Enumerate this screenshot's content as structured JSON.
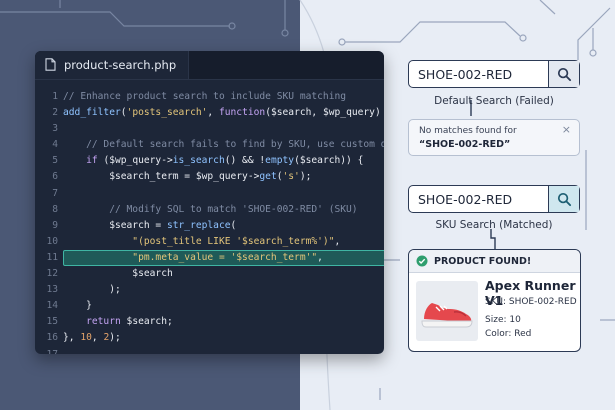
{
  "editor": {
    "tab_label": "product-search.php",
    "lines": [
      {
        "n": "1",
        "segs": [
          [
            "c-com",
            "// Enhance product search to include SKU matching"
          ]
        ]
      },
      {
        "n": "2",
        "segs": [
          [
            "c-fn",
            "add_filter"
          ],
          [
            "c-var",
            "("
          ],
          [
            "c-str",
            "'posts_search'"
          ],
          [
            "c-var",
            ", "
          ],
          [
            "c-kw",
            "function"
          ],
          [
            "c-var",
            "($search, $wp_query) {"
          ]
        ]
      },
      {
        "n": "3",
        "segs": []
      },
      {
        "n": "4",
        "segs": [
          [
            "c-com",
            "    // Default search fails to find by SKU, use custom query"
          ]
        ]
      },
      {
        "n": "5",
        "segs": [
          [
            "c-kw",
            "    if "
          ],
          [
            "c-var",
            "($wp_query->"
          ],
          [
            "c-fn",
            "is_search"
          ],
          [
            "c-var",
            "() && !"
          ],
          [
            "c-fn",
            "empty"
          ],
          [
            "c-var",
            "($search)) {"
          ]
        ]
      },
      {
        "n": "6",
        "segs": [
          [
            "c-var",
            "        $search_term = $wp_query->"
          ],
          [
            "c-fn",
            "get"
          ],
          [
            "c-var",
            "("
          ],
          [
            "c-str",
            "'s'"
          ],
          [
            "c-var",
            ");"
          ]
        ]
      },
      {
        "n": "7",
        "segs": []
      },
      {
        "n": "8",
        "segs": [
          [
            "c-com",
            "        // Modify SQL to match 'SHOE-002-RED' (SKU)"
          ]
        ]
      },
      {
        "n": "9",
        "segs": [
          [
            "c-var",
            "        $search = "
          ],
          [
            "c-fn",
            "str_replace"
          ],
          [
            "c-var",
            "("
          ]
        ]
      },
      {
        "n": "10",
        "segs": [
          [
            "c-str",
            "            \"(post_title LIKE '$search_term%')\""
          ],
          [
            "c-var",
            ","
          ]
        ]
      },
      {
        "n": "11",
        "segs": [
          [
            "c-str",
            "            \"pm.meta_value = '$search_term'\""
          ],
          [
            "c-var",
            ","
          ]
        ],
        "highlight": true
      },
      {
        "n": "12",
        "segs": [
          [
            "c-var",
            "            $search"
          ]
        ]
      },
      {
        "n": "13",
        "segs": [
          [
            "c-var",
            "        );"
          ]
        ]
      },
      {
        "n": "14",
        "segs": [
          [
            "c-var",
            "    }"
          ]
        ]
      },
      {
        "n": "15",
        "segs": [
          [
            "c-kw",
            "    return "
          ],
          [
            "c-var",
            "$search;"
          ]
        ]
      },
      {
        "n": "16",
        "segs": [
          [
            "c-var",
            "}, "
          ],
          [
            "c-num",
            "10"
          ],
          [
            "c-var",
            ", "
          ],
          [
            "c-num",
            "2"
          ],
          [
            "c-var",
            ");"
          ]
        ]
      },
      {
        "n": "17",
        "segs": []
      }
    ]
  },
  "default_search": {
    "value": "SHOE-002-RED",
    "caption": "Default Search (Failed)",
    "no_match_line1": "No matches found for",
    "no_match_line2": "“SHOE-002-RED”",
    "close_glyph": "×"
  },
  "sku_search": {
    "value": "SHOE-002-RED",
    "caption": "SKU Search (Matched)"
  },
  "result": {
    "header": "PRODUCT FOUND!",
    "name": "Apex Runner V1",
    "sku": "SKU: SHOE-002-RED",
    "size": "Size: 10",
    "color": "Color: Red"
  },
  "colors": {
    "accent_teal": "#3fb5a3",
    "search_active_btn": "#cfe7ef",
    "search_default_btn": "#e4e9f1",
    "success_green": "#2f9e6e",
    "shoe_red": "#e5484d"
  },
  "icons": {
    "file": "file-icon",
    "search": "search-icon",
    "check": "check-circle-icon",
    "close": "close-icon",
    "product": "sneaker-icon"
  }
}
